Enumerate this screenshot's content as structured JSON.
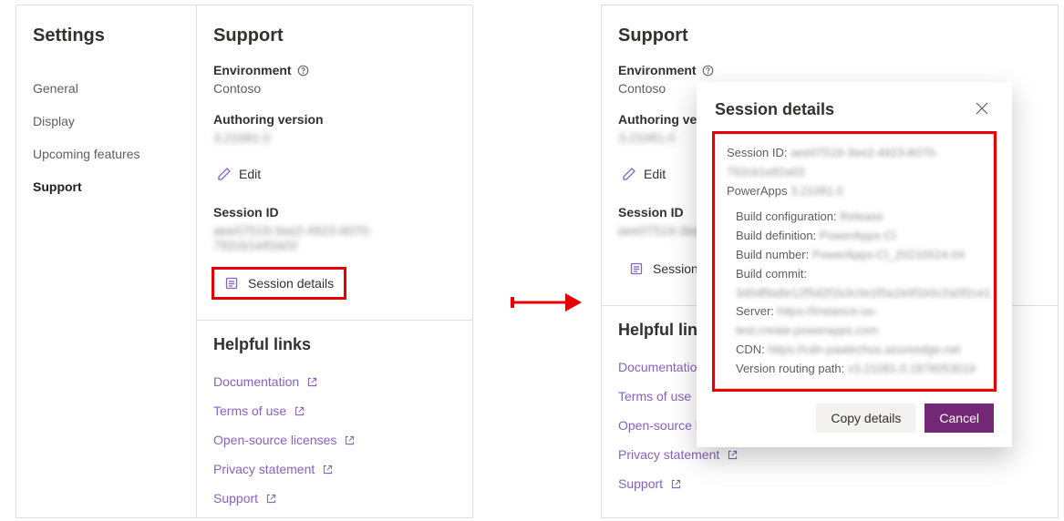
{
  "sidebar": {
    "title": "Settings",
    "items": [
      {
        "label": "General"
      },
      {
        "label": "Display"
      },
      {
        "label": "Upcoming features"
      },
      {
        "label": "Support"
      }
    ]
  },
  "support": {
    "heading": "Support",
    "env_label": "Environment",
    "env_value": "Contoso",
    "auth_label": "Authoring version",
    "auth_value": "3.21081.0",
    "edit_label": "Edit",
    "sess_label": "Session ID",
    "sess_value": "aee07519-3ee2-4923-8070-792cb1e82a02",
    "sess_details_label": "Session details",
    "links_heading": "Helpful links",
    "links": [
      {
        "label": "Documentation"
      },
      {
        "label": "Terms of use"
      },
      {
        "label": "Open-source licenses"
      },
      {
        "label": "Privacy statement"
      },
      {
        "label": "Support"
      }
    ]
  },
  "dialog": {
    "title": "Session details",
    "session_id_label": "Session ID:",
    "session_id_value": "aee07519-3ee2-4923-8070-792cb1e82a02",
    "powerapps_label": "PowerApps",
    "powerapps_value": "3.21081.0",
    "build_config_label": "Build configuration:",
    "build_config_value": "Release",
    "build_def_label": "Build definition:",
    "build_def_value": "PowerApps-CI",
    "build_num_label": "Build number:",
    "build_num_value": "PowerApps-CI_20210524.04",
    "build_commit_label": "Build commit:",
    "build_commit_value": "3d0df9a8e12f5d2f1b3c0e1f0a1b0f1b0c2a0f2ce1",
    "server_label": "Server:",
    "server_value": "https://instance-us-test.create.powerapps.com",
    "cdn_label": "CDN:",
    "cdn_value": "https://cdn-paatechus.azureedge.net",
    "vrp_label": "Version routing path:",
    "vrp_value": "v3.21081.0.1878053019",
    "copy_btn": "Copy details",
    "cancel_btn": "Cancel"
  }
}
